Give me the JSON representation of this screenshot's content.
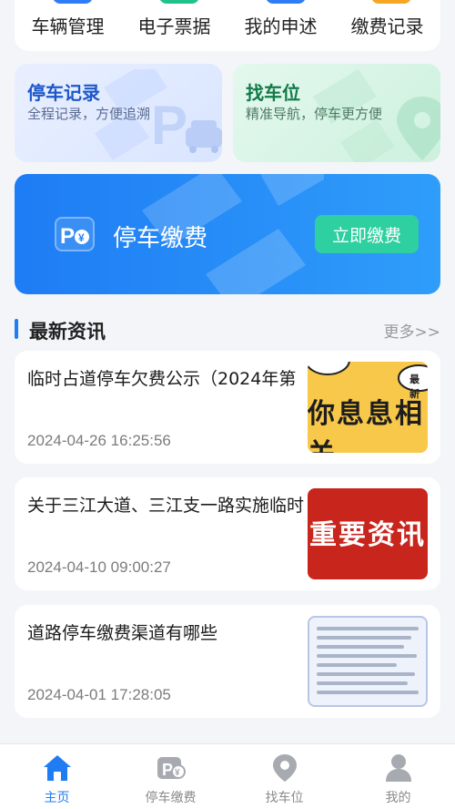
{
  "quick_menu": {
    "items": [
      {
        "label": "车辆管理"
      },
      {
        "label": "电子票据"
      },
      {
        "label": "我的申述"
      },
      {
        "label": "缴费记录"
      }
    ]
  },
  "cards": {
    "record": {
      "title": "停车记录",
      "subtitle": "全程记录，方便追溯",
      "icon": "parking-car-icon"
    },
    "find": {
      "title": "找车位",
      "subtitle": "精准导航，停车更方便",
      "icon": "location-pin-icon"
    }
  },
  "pay_banner": {
    "title": "停车缴费",
    "button_label": "立即缴费",
    "icon": "parking-pay-icon"
  },
  "news": {
    "header": "最新资讯",
    "more_label": "更多>>",
    "items": [
      {
        "title": "临时占道停车欠费公示（2024年第",
        "date": "2024-04-26 16:25:56",
        "thumb_text": "你息息相关",
        "thumb_badge": "最新"
      },
      {
        "title": "关于三江大道、三江支一路实施临时",
        "date": "2024-04-10 09:00:27",
        "thumb_text": "重要资讯"
      },
      {
        "title": "道路停车缴费渠道有哪些",
        "date": "2024-04-01 17:28:05"
      }
    ]
  },
  "tabbar": {
    "items": [
      {
        "label": "主页",
        "icon": "home-icon",
        "active": true
      },
      {
        "label": "停车缴费",
        "icon": "parking-pay-icon"
      },
      {
        "label": "找车位",
        "icon": "location-pin-icon"
      },
      {
        "label": "我的",
        "icon": "user-icon"
      }
    ]
  },
  "colors": {
    "primary": "#1f7cf3",
    "accent_button": "#2ecfa0",
    "background": "#f3f5f9"
  }
}
